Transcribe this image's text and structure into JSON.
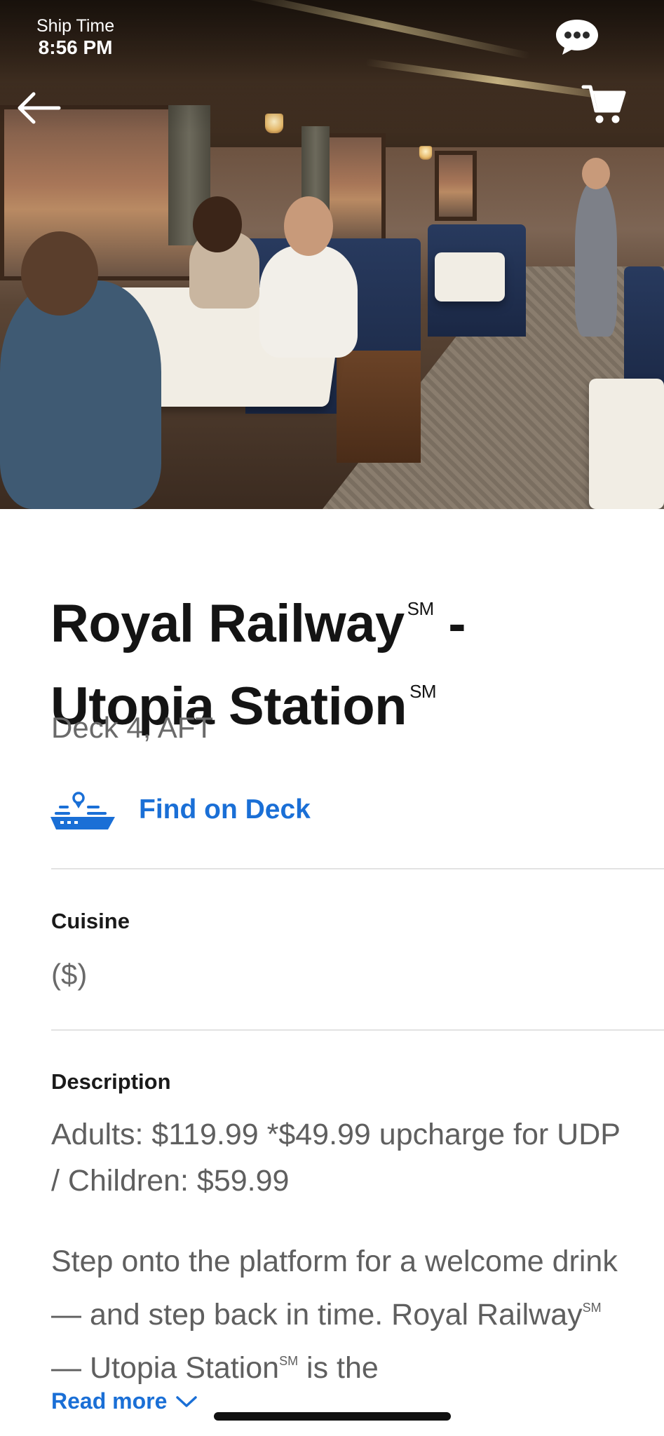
{
  "status": {
    "ship_time_label": "Ship Time",
    "ship_time_value": "8:56 PM"
  },
  "header": {
    "chat_icon": "chat-bubble-icon",
    "back_icon": "back-arrow-icon",
    "cart_icon": "cart-icon"
  },
  "venue": {
    "title_line1": "Royal Railway",
    "title_mark1": "SM",
    "title_dash": " -",
    "title_line2": "Utopia Station",
    "title_mark2": "SM",
    "location": "Deck 4, AFT"
  },
  "find_on_deck": {
    "icon": "ship-location-icon",
    "label": "Find on Deck"
  },
  "cuisine": {
    "heading": "Cuisine",
    "value": "($)"
  },
  "description": {
    "heading": "Description",
    "pricing": "Adults: $119.99 *$49.99 upcharge for UDP / Children: $59.99",
    "body_part1": "Step onto the platform for a welcome drink — and step back in time. Royal Railway",
    "body_mark1": "SM",
    "body_part2": " — Utopia Station",
    "body_mark2": "SM",
    "body_part3": " is the",
    "read_more": "Read more"
  },
  "colors": {
    "accent": "#1a6fd6",
    "title": "#141414",
    "muted": "#6a6a6a"
  }
}
